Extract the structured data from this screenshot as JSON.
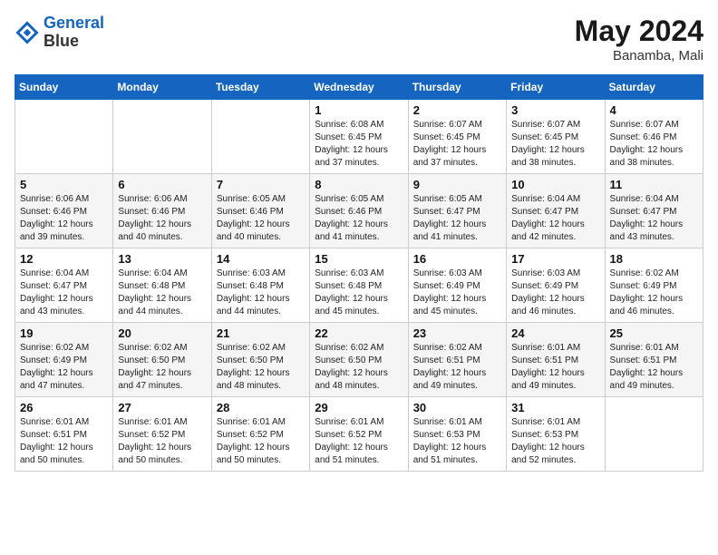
{
  "header": {
    "logo_line1": "General",
    "logo_line2": "Blue",
    "month_title": "May 2024",
    "location": "Banamba, Mali"
  },
  "weekdays": [
    "Sunday",
    "Monday",
    "Tuesday",
    "Wednesday",
    "Thursday",
    "Friday",
    "Saturday"
  ],
  "weeks": [
    [
      {
        "day": "",
        "info": ""
      },
      {
        "day": "",
        "info": ""
      },
      {
        "day": "",
        "info": ""
      },
      {
        "day": "1",
        "info": "Sunrise: 6:08 AM\nSunset: 6:45 PM\nDaylight: 12 hours\nand 37 minutes."
      },
      {
        "day": "2",
        "info": "Sunrise: 6:07 AM\nSunset: 6:45 PM\nDaylight: 12 hours\nand 37 minutes."
      },
      {
        "day": "3",
        "info": "Sunrise: 6:07 AM\nSunset: 6:45 PM\nDaylight: 12 hours\nand 38 minutes."
      },
      {
        "day": "4",
        "info": "Sunrise: 6:07 AM\nSunset: 6:46 PM\nDaylight: 12 hours\nand 38 minutes."
      }
    ],
    [
      {
        "day": "5",
        "info": "Sunrise: 6:06 AM\nSunset: 6:46 PM\nDaylight: 12 hours\nand 39 minutes."
      },
      {
        "day": "6",
        "info": "Sunrise: 6:06 AM\nSunset: 6:46 PM\nDaylight: 12 hours\nand 40 minutes."
      },
      {
        "day": "7",
        "info": "Sunrise: 6:05 AM\nSunset: 6:46 PM\nDaylight: 12 hours\nand 40 minutes."
      },
      {
        "day": "8",
        "info": "Sunrise: 6:05 AM\nSunset: 6:46 PM\nDaylight: 12 hours\nand 41 minutes."
      },
      {
        "day": "9",
        "info": "Sunrise: 6:05 AM\nSunset: 6:47 PM\nDaylight: 12 hours\nand 41 minutes."
      },
      {
        "day": "10",
        "info": "Sunrise: 6:04 AM\nSunset: 6:47 PM\nDaylight: 12 hours\nand 42 minutes."
      },
      {
        "day": "11",
        "info": "Sunrise: 6:04 AM\nSunset: 6:47 PM\nDaylight: 12 hours\nand 43 minutes."
      }
    ],
    [
      {
        "day": "12",
        "info": "Sunrise: 6:04 AM\nSunset: 6:47 PM\nDaylight: 12 hours\nand 43 minutes."
      },
      {
        "day": "13",
        "info": "Sunrise: 6:04 AM\nSunset: 6:48 PM\nDaylight: 12 hours\nand 44 minutes."
      },
      {
        "day": "14",
        "info": "Sunrise: 6:03 AM\nSunset: 6:48 PM\nDaylight: 12 hours\nand 44 minutes."
      },
      {
        "day": "15",
        "info": "Sunrise: 6:03 AM\nSunset: 6:48 PM\nDaylight: 12 hours\nand 45 minutes."
      },
      {
        "day": "16",
        "info": "Sunrise: 6:03 AM\nSunset: 6:49 PM\nDaylight: 12 hours\nand 45 minutes."
      },
      {
        "day": "17",
        "info": "Sunrise: 6:03 AM\nSunset: 6:49 PM\nDaylight: 12 hours\nand 46 minutes."
      },
      {
        "day": "18",
        "info": "Sunrise: 6:02 AM\nSunset: 6:49 PM\nDaylight: 12 hours\nand 46 minutes."
      }
    ],
    [
      {
        "day": "19",
        "info": "Sunrise: 6:02 AM\nSunset: 6:49 PM\nDaylight: 12 hours\nand 47 minutes."
      },
      {
        "day": "20",
        "info": "Sunrise: 6:02 AM\nSunset: 6:50 PM\nDaylight: 12 hours\nand 47 minutes."
      },
      {
        "day": "21",
        "info": "Sunrise: 6:02 AM\nSunset: 6:50 PM\nDaylight: 12 hours\nand 48 minutes."
      },
      {
        "day": "22",
        "info": "Sunrise: 6:02 AM\nSunset: 6:50 PM\nDaylight: 12 hours\nand 48 minutes."
      },
      {
        "day": "23",
        "info": "Sunrise: 6:02 AM\nSunset: 6:51 PM\nDaylight: 12 hours\nand 49 minutes."
      },
      {
        "day": "24",
        "info": "Sunrise: 6:01 AM\nSunset: 6:51 PM\nDaylight: 12 hours\nand 49 minutes."
      },
      {
        "day": "25",
        "info": "Sunrise: 6:01 AM\nSunset: 6:51 PM\nDaylight: 12 hours\nand 49 minutes."
      }
    ],
    [
      {
        "day": "26",
        "info": "Sunrise: 6:01 AM\nSunset: 6:51 PM\nDaylight: 12 hours\nand 50 minutes."
      },
      {
        "day": "27",
        "info": "Sunrise: 6:01 AM\nSunset: 6:52 PM\nDaylight: 12 hours\nand 50 minutes."
      },
      {
        "day": "28",
        "info": "Sunrise: 6:01 AM\nSunset: 6:52 PM\nDaylight: 12 hours\nand 50 minutes."
      },
      {
        "day": "29",
        "info": "Sunrise: 6:01 AM\nSunset: 6:52 PM\nDaylight: 12 hours\nand 51 minutes."
      },
      {
        "day": "30",
        "info": "Sunrise: 6:01 AM\nSunset: 6:53 PM\nDaylight: 12 hours\nand 51 minutes."
      },
      {
        "day": "31",
        "info": "Sunrise: 6:01 AM\nSunset: 6:53 PM\nDaylight: 12 hours\nand 52 minutes."
      },
      {
        "day": "",
        "info": ""
      }
    ]
  ]
}
